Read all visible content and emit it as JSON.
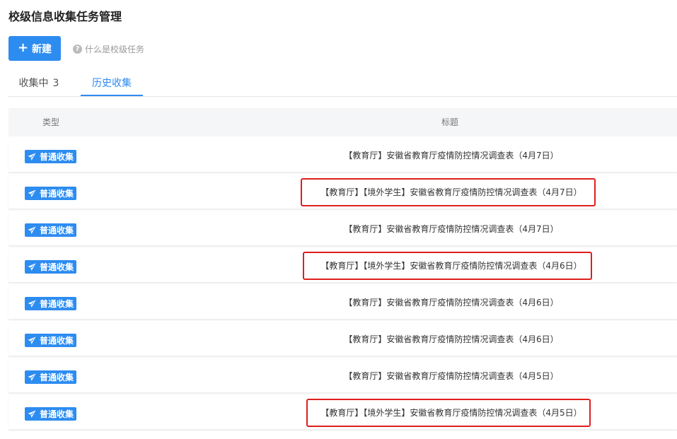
{
  "page": {
    "title": "校级信息收集任务管理"
  },
  "toolbar": {
    "new_label": "新建",
    "help_label": "什么是校级任务"
  },
  "tabs": [
    {
      "label": "收集中",
      "count": "3",
      "active": false
    },
    {
      "label": "历史收集",
      "active": true
    }
  ],
  "table": {
    "headers": {
      "type": "类型",
      "title": "标题"
    },
    "rows": [
      {
        "type": "普通收集",
        "title": "【教育厅】安徽省教育厅疫情防控情况调查表（4月7日）",
        "highlighted": false
      },
      {
        "type": "普通收集",
        "title": "【教育厅】【境外学生】安徽省教育厅疫情防控情况调查表（4月7日）",
        "highlighted": true
      },
      {
        "type": "普通收集",
        "title": "【教育厅】安徽省教育厅疫情防控情况调查表（4月7日）",
        "highlighted": false
      },
      {
        "type": "普通收集",
        "title": "【教育厅】【境外学生】安徽省教育厅疫情防控情况调查表（4月6日）",
        "highlighted": true
      },
      {
        "type": "普通收集",
        "title": "【教育厅】安徽省教育厅疫情防控情况调查表（4月6日）",
        "highlighted": false
      },
      {
        "type": "普通收集",
        "title": "【教育厅】安徽省教育厅疫情防控情况调查表（4月6日）",
        "highlighted": false
      },
      {
        "type": "普通收集",
        "title": "【教育厅】安徽省教育厅疫情防控情况调查表（4月5日）",
        "highlighted": false
      },
      {
        "type": "普通收集",
        "title": "【教育厅】【境外学生】安徽省教育厅疫情防控情况调查表（4月5日）",
        "highlighted": true
      }
    ]
  },
  "colors": {
    "accent": "#2d8cf0",
    "highlight": "#e01e1e"
  },
  "icons": {
    "badge_icon": "send-icon",
    "help_icon": "question-circle-icon",
    "new_icon": "plus-icon"
  }
}
